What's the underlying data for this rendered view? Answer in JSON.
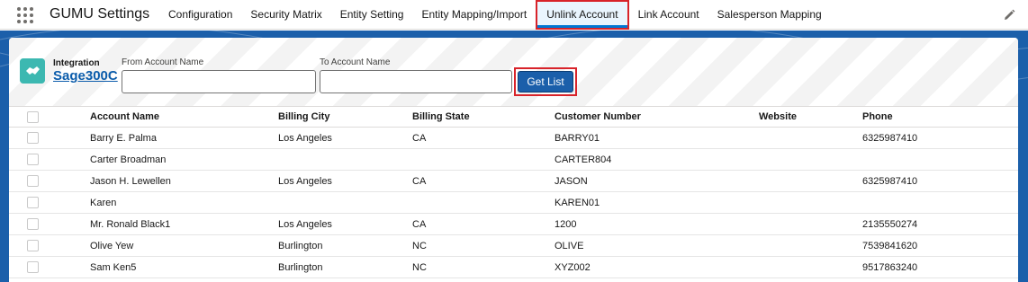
{
  "navbar": {
    "app_name": "GUMU Settings",
    "tabs": [
      {
        "label": "Configuration"
      },
      {
        "label": "Security Matrix"
      },
      {
        "label": "Entity Setting"
      },
      {
        "label": "Entity Mapping/Import"
      },
      {
        "label": "Unlink Account",
        "active": true
      },
      {
        "label": "Link Account"
      },
      {
        "label": "Salesperson Mapping"
      }
    ]
  },
  "filter": {
    "integration_label": "Integration",
    "integration_value": "Sage300C",
    "from_label": "From Account Name",
    "from_value": "",
    "to_label": "To Account Name",
    "to_value": "",
    "get_list_label": "Get List"
  },
  "table": {
    "columns": [
      "Account Name",
      "Billing City",
      "Billing State",
      "Customer Number",
      "Website",
      "Phone"
    ],
    "rows": [
      {
        "account": "Barry E. Palma",
        "city": "Los Angeles",
        "state": "CA",
        "number": "BARRY01",
        "website": "",
        "phone": "6325987410"
      },
      {
        "account": "Carter Broadman",
        "city": "",
        "state": "",
        "number": "CARTER804",
        "website": "",
        "phone": ""
      },
      {
        "account": "Jason H. Lewellen",
        "city": "Los Angeles",
        "state": "CA",
        "number": "JASON",
        "website": "",
        "phone": "6325987410"
      },
      {
        "account": "Karen",
        "city": "",
        "state": "",
        "number": "KAREN01",
        "website": "",
        "phone": ""
      },
      {
        "account": "Mr. Ronald Black1",
        "city": "Los Angeles",
        "state": "CA",
        "number": "1200",
        "website": "",
        "phone": "2135550274"
      },
      {
        "account": "Olive Yew",
        "city": "Burlington",
        "state": "NC",
        "number": "OLIVE",
        "website": "",
        "phone": "7539841620"
      },
      {
        "account": "Sam Ken5",
        "city": "Burlington",
        "state": "NC",
        "number": "XYZ002",
        "website": "",
        "phone": "9517863240"
      }
    ]
  },
  "colors": {
    "brand_blue": "#1b5faa",
    "highlight_red": "#d8232a",
    "integration_teal": "#3cb8b1",
    "link_blue": "#0b5cab"
  },
  "icons": {
    "app_launcher": "grid-icon",
    "integration": "handshake-icon",
    "edit": "pencil-icon"
  }
}
